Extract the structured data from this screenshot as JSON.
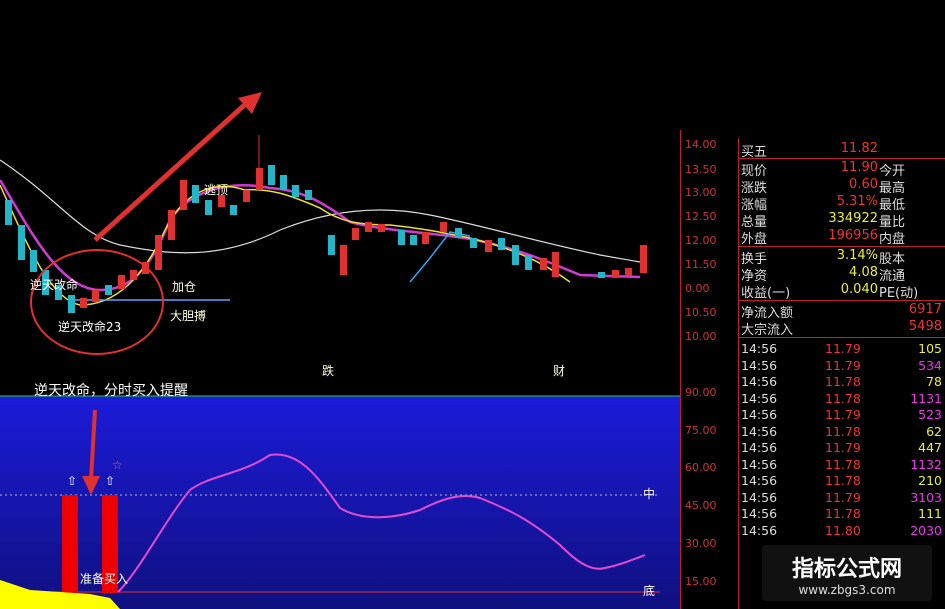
{
  "chart_annotations": {
    "nitian_gaiming": "逆天改命",
    "nitian_gaiming23": "逆天改命23",
    "jiacang": "加仓",
    "taoding": "逃顶",
    "dadanbo": "大胆搏",
    "die": "跌",
    "cai": "财"
  },
  "price_axis": [
    "14.00",
    "13.50",
    "13.00",
    "12.50",
    "12.00",
    "11.50",
    "0.00",
    "10.50",
    "10.00"
  ],
  "indicator": {
    "title": "逆天改命，分时买入提醒",
    "zhong": "中",
    "di": "底",
    "zhunbei": "准备买入",
    "axis": [
      "90.00",
      "75.00",
      "60.00",
      "45.00",
      "30.00",
      "15.00"
    ]
  },
  "quote": {
    "buy5_label": "买五",
    "buy5_value": "11.82",
    "rows": [
      {
        "l": "现价",
        "v": "11.90",
        "c": "red",
        "l2": "今开"
      },
      {
        "l": "涨跌",
        "v": "0.60",
        "c": "red",
        "l2": "最高"
      },
      {
        "l": "涨幅",
        "v": "5.31%",
        "c": "red",
        "l2": "最低"
      },
      {
        "l": "总量",
        "v": "334922",
        "c": "yellow",
        "l2": "量比"
      },
      {
        "l": "外盘",
        "v": "196956",
        "c": "red",
        "l2": "内盘"
      }
    ],
    "rows2": [
      {
        "l": "换手",
        "v": "3.14%",
        "c": "yellow",
        "l2": "股本"
      },
      {
        "l": "净资",
        "v": "4.08",
        "c": "yellow",
        "l2": "流通"
      },
      {
        "l": "收益(一)",
        "v": "0.040",
        "c": "yellow",
        "l2": "PE(动)"
      }
    ],
    "net_inflow_label": "净流入额",
    "net_inflow_value": "6917",
    "block_inflow_label": "大宗流入",
    "block_inflow_value": "5498"
  },
  "ticks": [
    {
      "t": "14:56",
      "p": "11.79",
      "v": "105",
      "c": "yellow"
    },
    {
      "t": "14:56",
      "p": "11.79",
      "v": "534",
      "c": "magenta"
    },
    {
      "t": "14:56",
      "p": "11.78",
      "v": "78",
      "c": "yellow"
    },
    {
      "t": "14:56",
      "p": "11.78",
      "v": "1131",
      "c": "magenta"
    },
    {
      "t": "14:56",
      "p": "11.79",
      "v": "523",
      "c": "magenta"
    },
    {
      "t": "14:56",
      "p": "11.78",
      "v": "62",
      "c": "yellow"
    },
    {
      "t": "14:56",
      "p": "11.79",
      "v": "447",
      "c": "yellow"
    },
    {
      "t": "14:56",
      "p": "11.78",
      "v": "1132",
      "c": "magenta"
    },
    {
      "t": "14:56",
      "p": "11.78",
      "v": "210",
      "c": "yellow"
    },
    {
      "t": "14:56",
      "p": "11.79",
      "v": "3103",
      "c": "magenta"
    },
    {
      "t": "14:56",
      "p": "11.78",
      "v": "111",
      "c": "yellow"
    },
    {
      "t": "14:56",
      "p": "11.80",
      "v": "2030",
      "c": "magenta"
    }
  ],
  "watermark": {
    "title": "指标公式网",
    "url": "www.zbgs3.com"
  }
}
